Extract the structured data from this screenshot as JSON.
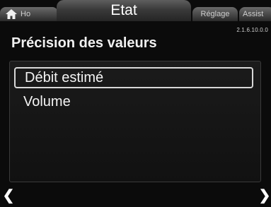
{
  "tabs": {
    "home_label": "Ho",
    "home_icon": "home-icon",
    "active_label": "Etat",
    "reglage_label": "Réglage",
    "assist_label": "Assist"
  },
  "version": "2.1.6.10.0.0",
  "page": {
    "title": "Précision des valeurs"
  },
  "list": {
    "items": [
      {
        "label": "Débit estimé",
        "selected": true
      },
      {
        "label": "Volume",
        "selected": false
      }
    ]
  },
  "nav": {
    "left_icon": "chevron-left-icon",
    "right_icon": "chevron-right-icon"
  }
}
